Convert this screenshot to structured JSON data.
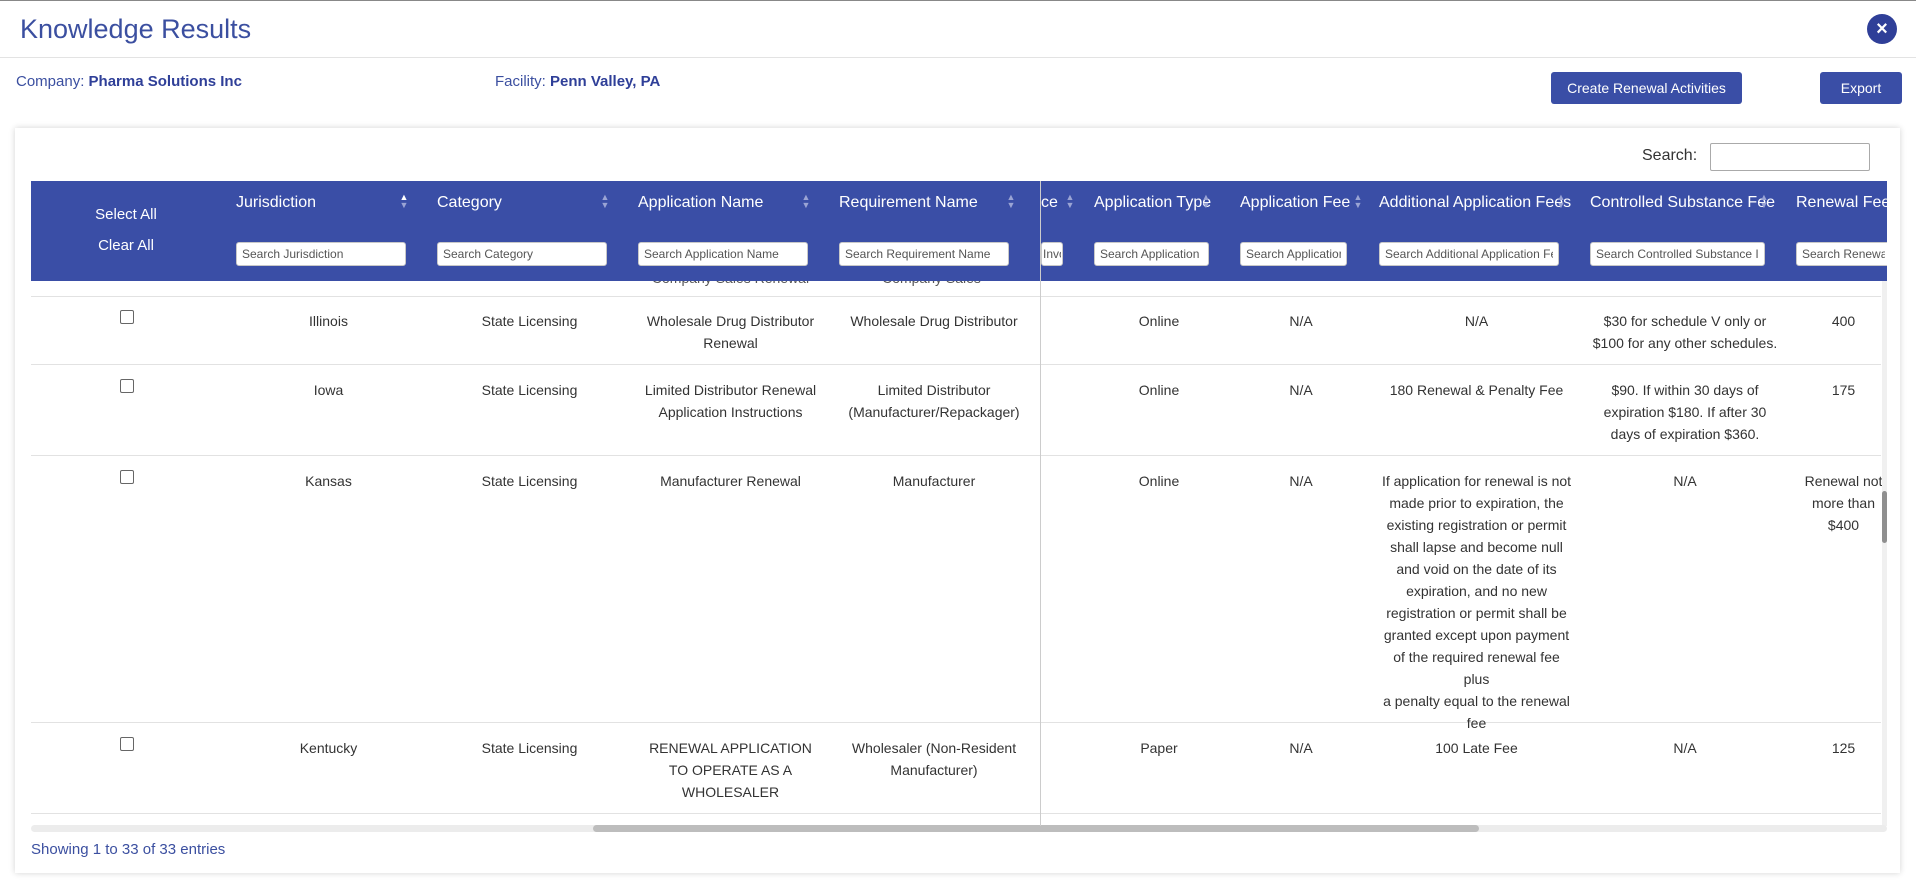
{
  "modal": {
    "title": "Knowledge Results",
    "close_icon": "×"
  },
  "company": {
    "label": "Company:",
    "value": "Pharma Solutions Inc"
  },
  "facility": {
    "label": "Facility:",
    "value": "Penn Valley, PA"
  },
  "buttons": {
    "create_renewal": "Create Renewal Activities",
    "export": "Export"
  },
  "search": {
    "label": "Search:",
    "value": ""
  },
  "table": {
    "select_all": "Select All",
    "clear_all": "Clear All",
    "columns": [
      {
        "label": "Jurisdiction",
        "placeholder": "Search Jurisdiction"
      },
      {
        "label": "Category",
        "placeholder": "Search Category"
      },
      {
        "label": "Application Name",
        "placeholder": "Search Application Name"
      },
      {
        "label": "Requirement Name",
        "placeholder": "Search Requirement Name"
      },
      {
        "label": "ce",
        "placeholder": "Invo"
      },
      {
        "label": "Application Type",
        "placeholder": "Search Application"
      },
      {
        "label": "Application Fee",
        "placeholder": "Search Application"
      },
      {
        "label": "Additional Application Fees",
        "placeholder": "Search Additional Application Fe"
      },
      {
        "label": "Controlled Substance Fee",
        "placeholder": "Search Controlled Substance I"
      },
      {
        "label": "Renewal Fee",
        "placeholder": "Search Renewa"
      }
    ],
    "partial_row": {
      "application_name": "Company Sales Renewal",
      "requirement_name": "Company Sales"
    },
    "rows": [
      {
        "jurisdiction": "Illinois",
        "category": "State Licensing",
        "application_name": [
          "Wholesale Drug Distributor",
          "Renewal"
        ],
        "requirement_name": [
          "Wholesale Drug Distributor"
        ],
        "application_type": "Online",
        "application_fee": "N/A",
        "additional_fees": [
          "N/A"
        ],
        "controlled_substance_fee": [
          "$30 for schedule V only or",
          "$100 for any other schedules."
        ],
        "renewal_fee": [
          "400"
        ]
      },
      {
        "jurisdiction": "Iowa",
        "category": "State Licensing",
        "application_name": [
          "Limited Distributor Renewal",
          "Application Instructions"
        ],
        "requirement_name": [
          "Limited Distributor",
          "(Manufacturer/Repackager)"
        ],
        "application_type": "Online",
        "application_fee": "N/A",
        "additional_fees": [
          "180 Renewal & Penalty Fee"
        ],
        "controlled_substance_fee": [
          "$90. If within 30 days of",
          "expiration $180. If after 30",
          "days of expiration $360."
        ],
        "renewal_fee": [
          "175"
        ]
      },
      {
        "jurisdiction": "Kansas",
        "category": "State Licensing",
        "application_name": [
          "Manufacturer Renewal"
        ],
        "requirement_name": [
          "Manufacturer"
        ],
        "application_type": "Online",
        "application_fee": "N/A",
        "additional_fees": [
          "If application for renewal is not",
          "made prior to expiration, the",
          "existing registration or permit",
          "shall lapse and become null",
          "and void on the date of its",
          "expiration, and no new",
          "registration or permit shall be",
          "granted except upon payment",
          "of the required renewal fee plus",
          "a penalty equal to the renewal",
          "fee"
        ],
        "controlled_substance_fee": [
          "N/A"
        ],
        "renewal_fee": [
          "Renewal not",
          "more than $400"
        ]
      },
      {
        "jurisdiction": "Kentucky",
        "category": "State Licensing",
        "application_name": [
          "RENEWAL APPLICATION",
          "TO OPERATE AS A",
          "WHOLESALER"
        ],
        "requirement_name": [
          "Wholesaler (Non-Resident",
          "Manufacturer)"
        ],
        "application_type": "Paper",
        "application_fee": "N/A",
        "additional_fees": [
          "100 Late Fee"
        ],
        "controlled_substance_fee": [
          "N/A"
        ],
        "renewal_fee": [
          "125"
        ]
      }
    ]
  },
  "footer": {
    "showing": "Showing 1 to 33 of 33 entries"
  }
}
